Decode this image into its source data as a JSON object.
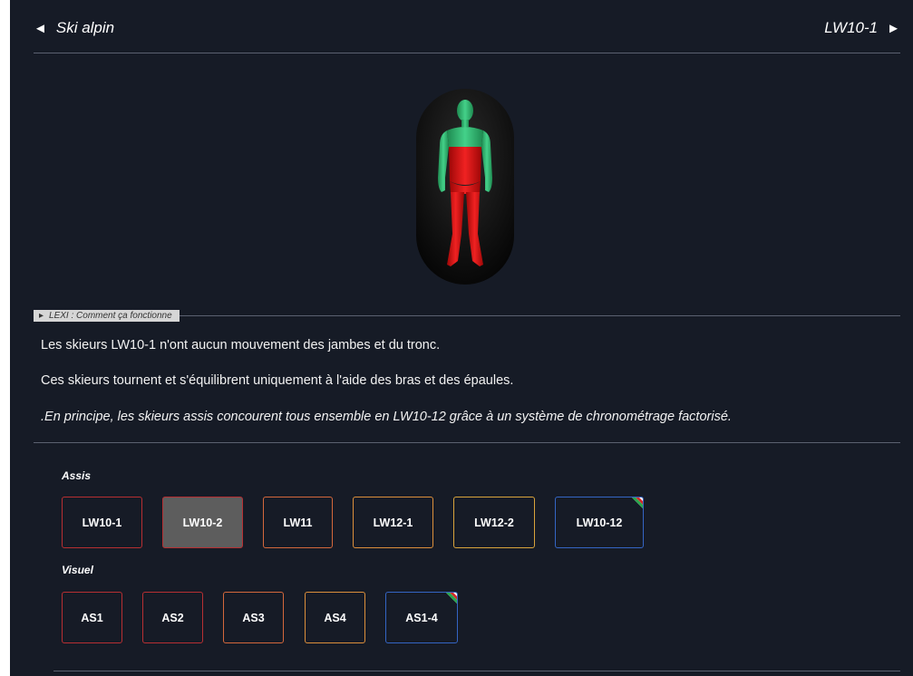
{
  "nav": {
    "prev_label": "Ski alpin",
    "next_label": "LW10-1",
    "prev_arrow": "◄",
    "next_arrow": "►"
  },
  "lexi": {
    "label": "LEXI : Comment ça fonctionne",
    "arrow": "▸"
  },
  "description": [
    "Les skieurs LW10-1 n'ont aucun mouvement des jambes et du tronc.",
    "Ces skieurs tournent et s'équilibrent uniquement à l'aide des bras et des épaules.",
    ".En principe, les skieurs assis concourent tous ensemble en LW10-12 grâce à un système de chronométrage factorisé."
  ],
  "groups": {
    "assis": {
      "label": "Assis",
      "buttons": [
        "LW10-1",
        "LW10-2",
        "LW11",
        "LW12-1",
        "LW12-2",
        "LW10-12"
      ]
    },
    "visuel": {
      "label": "Visuel",
      "buttons": [
        "AS1",
        "AS2",
        "AS3",
        "AS4",
        "AS1-4"
      ]
    }
  },
  "colors": {
    "panel_bg": "#161b26",
    "impaired": "#d10f0f",
    "functional": "#29b36a",
    "red_border": "#b72f32",
    "orange_border": "#d4683c",
    "amber_border": "#dc8f3b",
    "gold_border": "#d9a43c",
    "blue_border": "#3465c4",
    "active_bg": "#5d5d5d"
  },
  "selected_button": "LW10-2"
}
